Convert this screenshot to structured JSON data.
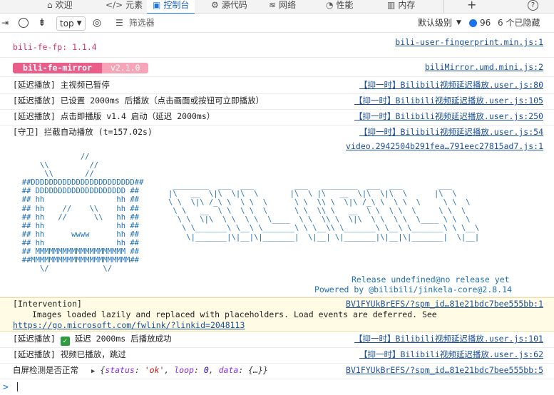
{
  "tabs": {
    "welcome": "欢迎",
    "elements": "元素",
    "console": "控制台",
    "sources": "源代码",
    "network": "网络",
    "performance": "性能",
    "memory": "内存",
    "more": "+",
    "help": "?"
  },
  "toolbar": {
    "context": "top",
    "filter_placeholder": "筛选器",
    "level": "默认级别",
    "issues_count": "96",
    "hidden": "6 个已隐藏"
  },
  "logs": {
    "fp_text": "bili-fe-fp: 1.1.4",
    "fp_src": "bili-user-fingerprint.min.js:1",
    "mirror_name": "bili-fe-mirror",
    "mirror_ver": "v2.1.0",
    "mirror_src": "biliMirror.umd.mini.js:2",
    "l1_text": "[延迟播放] 主视频已暂停",
    "l1_src": "【抑一时】Bilibili视频延迟播放.user.js:80",
    "l2_text": "[延迟播放] 已设置 2000ms 后播放（点击画面或按钮可立即播放）",
    "l2_src": "【抑一时】Bilibili视频延迟播放.user.js:105",
    "l3_text": "[延迟播放] 点击即播版 v1.4 启动（延迟 2000ms）",
    "l3_src": "【抑一时】Bilibili视频延迟播放.user.js:250",
    "l4_text": "[守卫] 拦截自动播放 (t=157.02s)",
    "l4_src": "【抑一时】Bilibili视频延迟播放.user.js:54",
    "video_src": "video.2942504b291fea…791eec27815ad7.js:1",
    "ascii_left": "               //\n      \\\\         //\n       \\\\       //\n  ##DDDDDDDDDDDDDDDDDDDDDDD##\n  ## DDDDDDDDDDDDDDDDDDDD ##\n  ## hh                hh ##\n  ## hh    //    \\\\    hh ##\n  ## hh   //      \\\\   hh ##\n  ## hh                hh ##\n  ## hh      wwww      hh ##\n  ## hh                hh ##\n  ## MMMMMMMMMMMMMMMMMMMM ##\n  ##MMMMMMMMMMMMMMMMMMMMMM##\n      \\/            \\/",
    "ascii_right": " ________  ___  ___         ___   ________  ___  ___        ___\n|\\   __  \\|\\  \\|\\  \\       |\\  \\ |\\   __  \\|\\  \\|\\  \\      |\\  \\\n\\ \\  \\|\\ /_\\ \\  \\ \\  \\      \\ \\  \\\\ \\  \\|\\ /_\\ \\  \\ \\  \\     \\ \\  \\\n \\ \\   __  \\ \\  \\ \\  \\      \\ \\  \\\\ \\   __  \\ \\  \\ \\  \\     \\ \\  \\\n  \\ \\  \\|\\  \\ \\  \\ \\  \\____  \\ \\  \\\\ \\  \\|\\  \\ \\  \\ \\  \\____ \\ \\  \\\n   \\ \\_______\\ \\__\\ \\_______\\ \\ \\__\\\\ \\_______\\ \\__\\ \\_______\\ \\ \\__\\\n    \\|_______|\\|__|\\|_______|  \\|__| \\|_______|\\|__|\\|_______|  \\|__|",
    "release": "Release undefined@no release yet",
    "powered": "Powered by @bilibili/jinkela-core@2.8.14",
    "intervention_title": "[Intervention]",
    "intervention_src": "BV1FYUkBrEFS/?spm_id…81e21bdc7bee555bb:1",
    "intervention_msg": "Images loaded lazily and replaced with placeholders. Load events are deferred. See",
    "intervention_link": "https://go.microsoft.com/fwlink/?linkid=2048113",
    "l5_prefix": "[延迟播放]",
    "l5_text": "延迟 2000ms 后播放成功",
    "l5_src": "【抑一时】Bilibili视频延迟播放.user.js:101",
    "l6_text": "[延迟播放] 视频已播放，跳过",
    "l6_src": "【抑一时】Bilibili视频延迟播放.user.js:62",
    "l7_text": "白屏检测是否正常",
    "l7_status_key": "status",
    "l7_status_val": "'ok'",
    "l7_loop_key": "loop",
    "l7_loop_val": "0",
    "l7_data_key": "data",
    "l7_data_val": "{…}",
    "l7_src": "BV1FYUkBrEFS/?spm_id…81e21bdc7bee555bb:5",
    "prompt": ">"
  }
}
